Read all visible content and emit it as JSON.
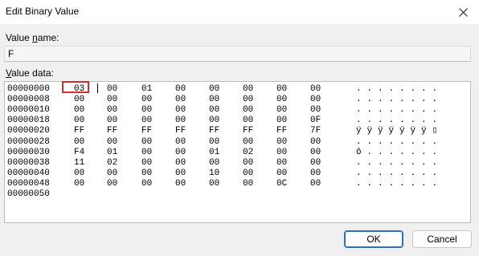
{
  "window": {
    "title": "Edit Binary Value"
  },
  "value_name": {
    "label_pre": "Value ",
    "label_u": "n",
    "label_post": "ame:",
    "value": "F"
  },
  "value_data": {
    "label_u": "V",
    "label_post": "alue data:",
    "rows": [
      {
        "addr": "00000000",
        "bytes": [
          "03",
          "00",
          "01",
          "00",
          "00",
          "00",
          "00",
          "00"
        ],
        "ascii": [
          ".",
          ".",
          ".",
          ".",
          ".",
          ".",
          ".",
          "."
        ]
      },
      {
        "addr": "00000008",
        "bytes": [
          "00",
          "00",
          "00",
          "00",
          "00",
          "00",
          "00",
          "00"
        ],
        "ascii": [
          ".",
          ".",
          ".",
          ".",
          ".",
          ".",
          ".",
          "."
        ]
      },
      {
        "addr": "00000010",
        "bytes": [
          "00",
          "00",
          "00",
          "00",
          "00",
          "00",
          "00",
          "00"
        ],
        "ascii": [
          ".",
          ".",
          ".",
          ".",
          ".",
          ".",
          ".",
          "."
        ]
      },
      {
        "addr": "00000018",
        "bytes": [
          "00",
          "00",
          "00",
          "00",
          "00",
          "00",
          "00",
          "0F"
        ],
        "ascii": [
          ".",
          ".",
          ".",
          ".",
          ".",
          ".",
          ".",
          "."
        ]
      },
      {
        "addr": "00000020",
        "bytes": [
          "FF",
          "FF",
          "FF",
          "FF",
          "FF",
          "FF",
          "FF",
          "7F"
        ],
        "ascii": [
          "ÿ",
          "ÿ",
          "ÿ",
          "ÿ",
          "ÿ",
          "ÿ",
          "ÿ",
          "▯"
        ]
      },
      {
        "addr": "00000028",
        "bytes": [
          "00",
          "00",
          "00",
          "00",
          "00",
          "00",
          "00",
          "00"
        ],
        "ascii": [
          ".",
          ".",
          ".",
          ".",
          ".",
          ".",
          ".",
          "."
        ]
      },
      {
        "addr": "00000030",
        "bytes": [
          "F4",
          "01",
          "00",
          "00",
          "01",
          "02",
          "00",
          "00"
        ],
        "ascii": [
          "ô",
          ".",
          ".",
          ".",
          ".",
          ".",
          ".",
          "."
        ]
      },
      {
        "addr": "00000038",
        "bytes": [
          "11",
          "02",
          "00",
          "00",
          "00",
          "00",
          "00",
          "00"
        ],
        "ascii": [
          ".",
          ".",
          ".",
          ".",
          ".",
          ".",
          ".",
          "."
        ]
      },
      {
        "addr": "00000040",
        "bytes": [
          "00",
          "00",
          "00",
          "00",
          "10",
          "00",
          "00",
          "00"
        ],
        "ascii": [
          ".",
          ".",
          ".",
          ".",
          ".",
          ".",
          ".",
          "."
        ]
      },
      {
        "addr": "00000048",
        "bytes": [
          "00",
          "00",
          "00",
          "00",
          "00",
          "00",
          "0C",
          "00"
        ],
        "ascii": [
          ".",
          ".",
          ".",
          ".",
          ".",
          ".",
          ".",
          "."
        ]
      },
      {
        "addr": "00000050",
        "bytes": [],
        "ascii": []
      }
    ]
  },
  "buttons": {
    "ok": "OK",
    "cancel": "Cancel"
  },
  "icons": {
    "close": "close-icon"
  },
  "colors": {
    "selection_box": "#d32f2f",
    "ok_border": "#2f6fb8"
  }
}
